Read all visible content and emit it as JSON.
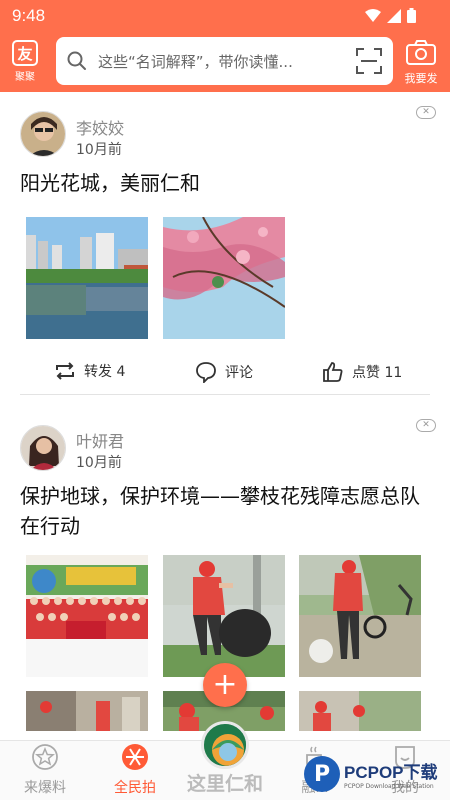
{
  "status": {
    "time": "9:48"
  },
  "header": {
    "logo_label": "聚聚",
    "logo_glyph": "友",
    "search_placeholder": "这些“名词解释”，带你读懂...",
    "camera_label": "我要发"
  },
  "colors": {
    "brand": "#ff6f4c",
    "active": "#ff5a36"
  },
  "posts": [
    {
      "author": "李姣姣",
      "time": "10月前",
      "title": "阳光花城，美丽仁和",
      "close_glyph": "✕",
      "actions": {
        "share": "转发 4",
        "comment": "评论",
        "like": "点赞 11"
      }
    },
    {
      "author": "叶妍君",
      "time": "10月前",
      "title": "保护地球，保护环境——攀枝花残障志愿总队在行动",
      "close_glyph": "✕"
    }
  ],
  "fab": {
    "glyph": "+"
  },
  "bottom_nav": {
    "items": [
      {
        "label": "来爆料"
      },
      {
        "label": "全民拍"
      },
      {
        "label": "这里仁和"
      },
      {
        "label": "融..."
      },
      {
        "label": "我的"
      }
    ]
  },
  "watermark": {
    "text": "PCPOP下载",
    "sub": "PCPOP Download Web Station",
    "glyph": "P"
  }
}
